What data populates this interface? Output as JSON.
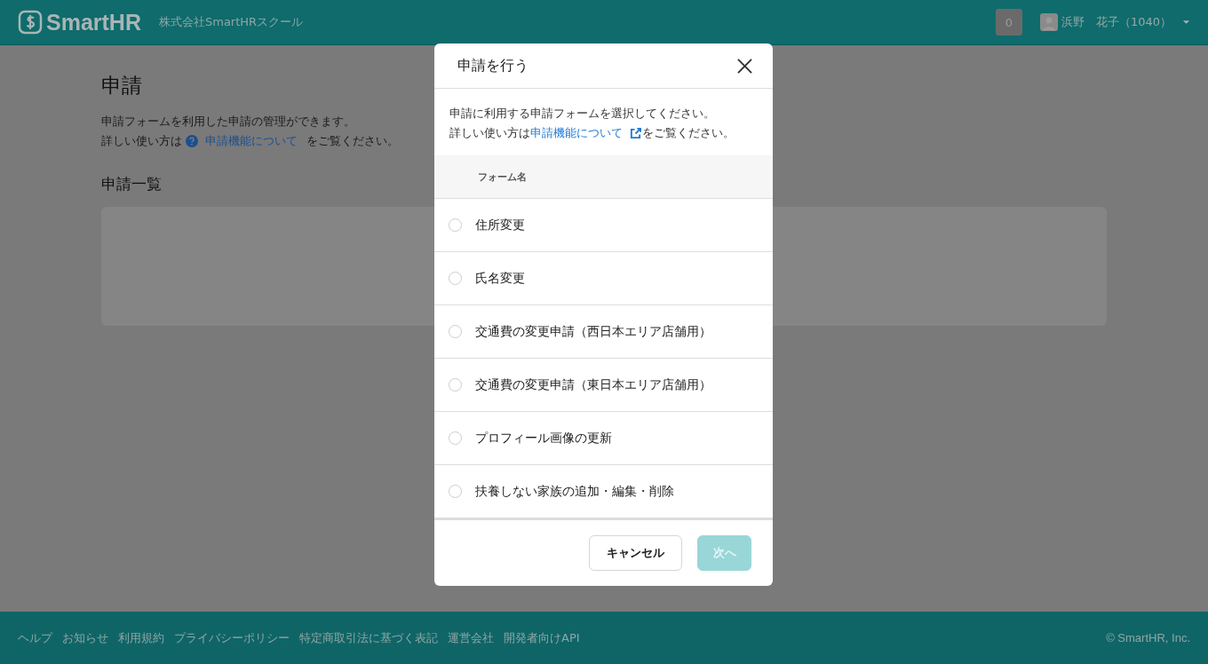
{
  "header": {
    "logo": "SmartHR",
    "company": "株式会社SmartHRスクール",
    "notification_count": "0",
    "user": "浜野　花子（1040）"
  },
  "page": {
    "title": "申請",
    "description": "申請フォームを利用した申請の管理ができます。",
    "help_prefix": "詳しい使い方は",
    "help_link": "申請機能について",
    "help_suffix": "をご覧ください。",
    "list_title": "申請一覧"
  },
  "dialog": {
    "title": "申請を行う",
    "description": "申請に利用する申請フォームを選択してください。",
    "help_prefix": "詳しい使い方は",
    "help_link": "申請機能について",
    "help_suffix": "をご覧ください。",
    "column": "フォーム名",
    "forms": [
      {
        "name": "住所変更",
        "selected": false
      },
      {
        "name": "氏名変更",
        "selected": false
      },
      {
        "name": "交通費の変更申請（西日本エリア店舗用）",
        "selected": false
      },
      {
        "name": "交通費の変更申請（東日本エリア店舗用）",
        "selected": false
      },
      {
        "name": "プロフィール画像の更新",
        "selected": false
      },
      {
        "name": "扶養しない家族の追加・編集・削除",
        "selected": false
      }
    ],
    "buttons": [
      {
        "label": "キャンセル",
        "kind": "secondary",
        "disabled": false
      },
      {
        "label": "次へ",
        "kind": "primary",
        "disabled": true
      }
    ]
  },
  "footer": {
    "links": [
      "ヘルプ",
      "お知らせ",
      "利用規約",
      "プライバシーポリシー",
      "特定商取引法に基づく表記",
      "運営会社",
      "開発者向けAPI"
    ],
    "copyright": "© SmartHR, Inc."
  }
}
